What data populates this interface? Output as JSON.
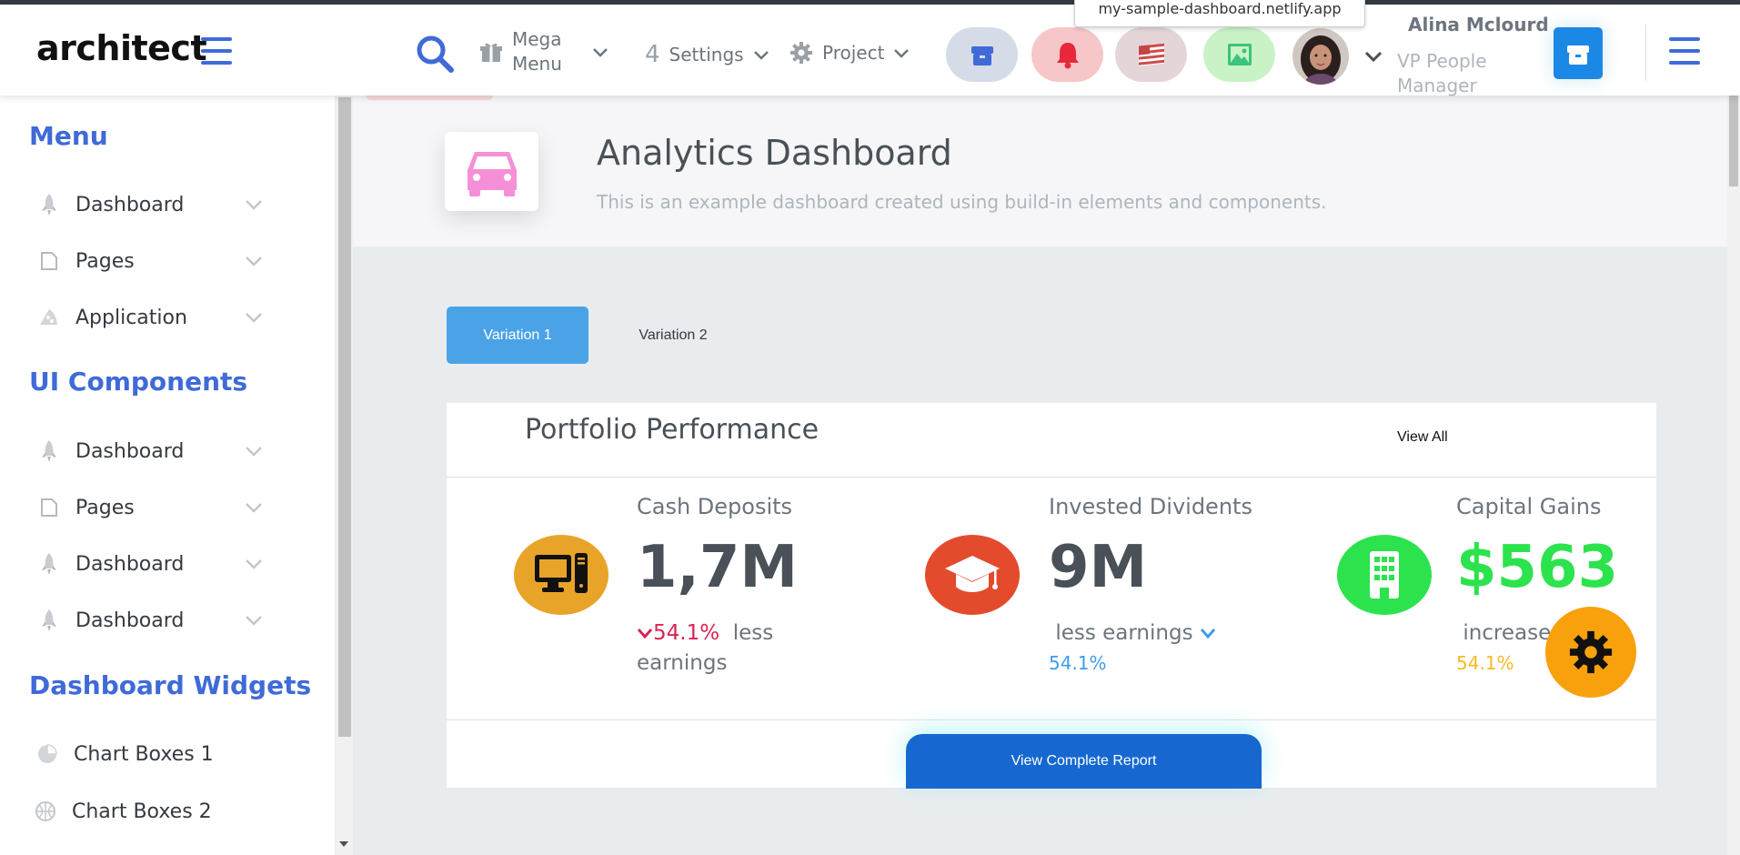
{
  "browser": {
    "url_tooltip": "my-sample-dashboard.netlify.app"
  },
  "header": {
    "logo": "architect",
    "mega_menu_label": "Mega Menu",
    "settings_label": "Settings",
    "settings_count": "4",
    "project_label": "Project",
    "user_name": "Alina Mclourd",
    "user_role": "VP People Manager"
  },
  "sidebar": {
    "sections": [
      {
        "heading": "Menu",
        "items": [
          {
            "label": "Dashboard",
            "icon": "rocket-icon"
          },
          {
            "label": "Pages",
            "icon": "page-icon"
          },
          {
            "label": "Application",
            "icon": "pizza-icon"
          }
        ]
      },
      {
        "heading": "UI Components",
        "items": [
          {
            "label": "Dashboard",
            "icon": "rocket-icon"
          },
          {
            "label": "Pages",
            "icon": "page-icon"
          },
          {
            "label": "Dashboard",
            "icon": "rocket-icon"
          },
          {
            "label": "Dashboard",
            "icon": "rocket-icon"
          }
        ]
      },
      {
        "heading": "Dashboard Widgets",
        "items": [
          {
            "label": "Chart Boxes 1",
            "icon": "pie-chart-icon"
          },
          {
            "label": "Chart Boxes 2",
            "icon": "ball-icon"
          }
        ]
      }
    ]
  },
  "page": {
    "title": "Analytics Dashboard",
    "subtitle": "This is an example dashboard created using build-in elements and components."
  },
  "tabs": [
    {
      "label": "Variation 1",
      "active": true
    },
    {
      "label": "Variation 2",
      "active": false
    }
  ],
  "card": {
    "title": "Portfolio Performance",
    "view_all": "View All",
    "stats": [
      {
        "label": "Cash Deposits",
        "value": "1,7M",
        "pct": "54.1%",
        "note": "less earnings",
        "icon": "computer-icon",
        "icon_bg": "#e8a429",
        "pct_color": "#d92550",
        "value_color": "#495057"
      },
      {
        "label": "Invested Dividents",
        "value": "9M",
        "pct": "54.1%",
        "note": "less earnings",
        "icon": "graduation-cap-icon",
        "icon_bg": "#e34b2c",
        "pct_color": "#3f9ce8",
        "value_color": "#495057"
      },
      {
        "label": "Capital Gains",
        "value": "$563",
        "pct": "54.1%",
        "note": "increased",
        "icon": "building-icon",
        "icon_bg": "#2ce34e",
        "pct_color": "#f7b924",
        "value_color": "#2ce34e"
      }
    ],
    "report_button": "View Complete Report"
  },
  "colors": {
    "primary": "#3f6ad8",
    "tab_active": "#4ba3e7",
    "report_button": "#1668d0",
    "fab": "#f8a10c"
  }
}
